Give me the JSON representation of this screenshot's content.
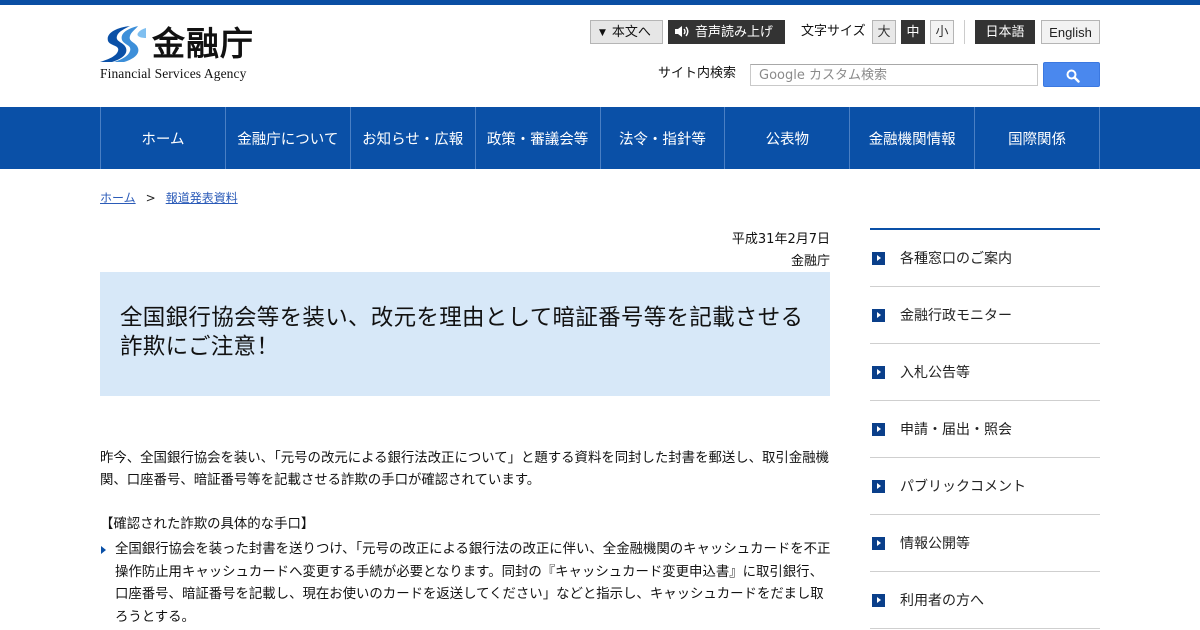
{
  "header": {
    "logo_ja": "金融庁",
    "logo_en": "Financial Services Agency",
    "skip_to_content": "本文へ",
    "voice_read": "音声読み上げ",
    "font_size_label": "文字サイズ",
    "font_sizes": [
      "大",
      "中",
      "小"
    ],
    "lang_ja": "日本語",
    "lang_en": "English",
    "search_label": "サイト内検索",
    "search_placeholder": "Google カスタム検索"
  },
  "nav": [
    "ホーム",
    "金融庁について",
    "お知らせ・広報",
    "政策・審議会等",
    "法令・指針等",
    "公表物",
    "金融機関情報",
    "国際関係"
  ],
  "breadcrumb": {
    "home": "ホーム",
    "separator": ">",
    "current": "報道発表資料"
  },
  "main": {
    "date": "平成31年2月7日",
    "issuer": "金融庁",
    "title": "全国銀行協会等を装い、改元を理由として暗証番号等を記載させる詐欺にご注意！",
    "intro": "昨今、全国銀行協会を装い、「元号の改元による銀行法改正について」と題する資料を同封した封書を郵送し、取引金融機関、口座番号、暗証番号等を記載させる詐欺の手口が確認されています。",
    "section_heading": "【確認された詐欺の具体的な手口】",
    "bullet1": "全国銀行協会を装った封書を送りつけ、「元号の改正による銀行法の改正に伴い、全金融機関のキャッシュカードを不正操作防止用キャッシュカードへ変更する手続が必要となります。同封の『キャッシュカード変更申込書』に取引銀行、口座番号、暗証番号を記載し、現在お使いのカードを返送してください」などと指示し、キャッシュカードをだまし取ろうとする。"
  },
  "sidebar": [
    "各種窓口のご案内",
    "金融行政モニター",
    "入札公告等",
    "申請・届出・照会",
    "パブリックコメント",
    "情報公開等",
    "利用者の方へ"
  ],
  "colors": {
    "brand_blue": "#0a50a7",
    "title_bg": "#d7e8f8",
    "search_button": "#4a88ee"
  }
}
